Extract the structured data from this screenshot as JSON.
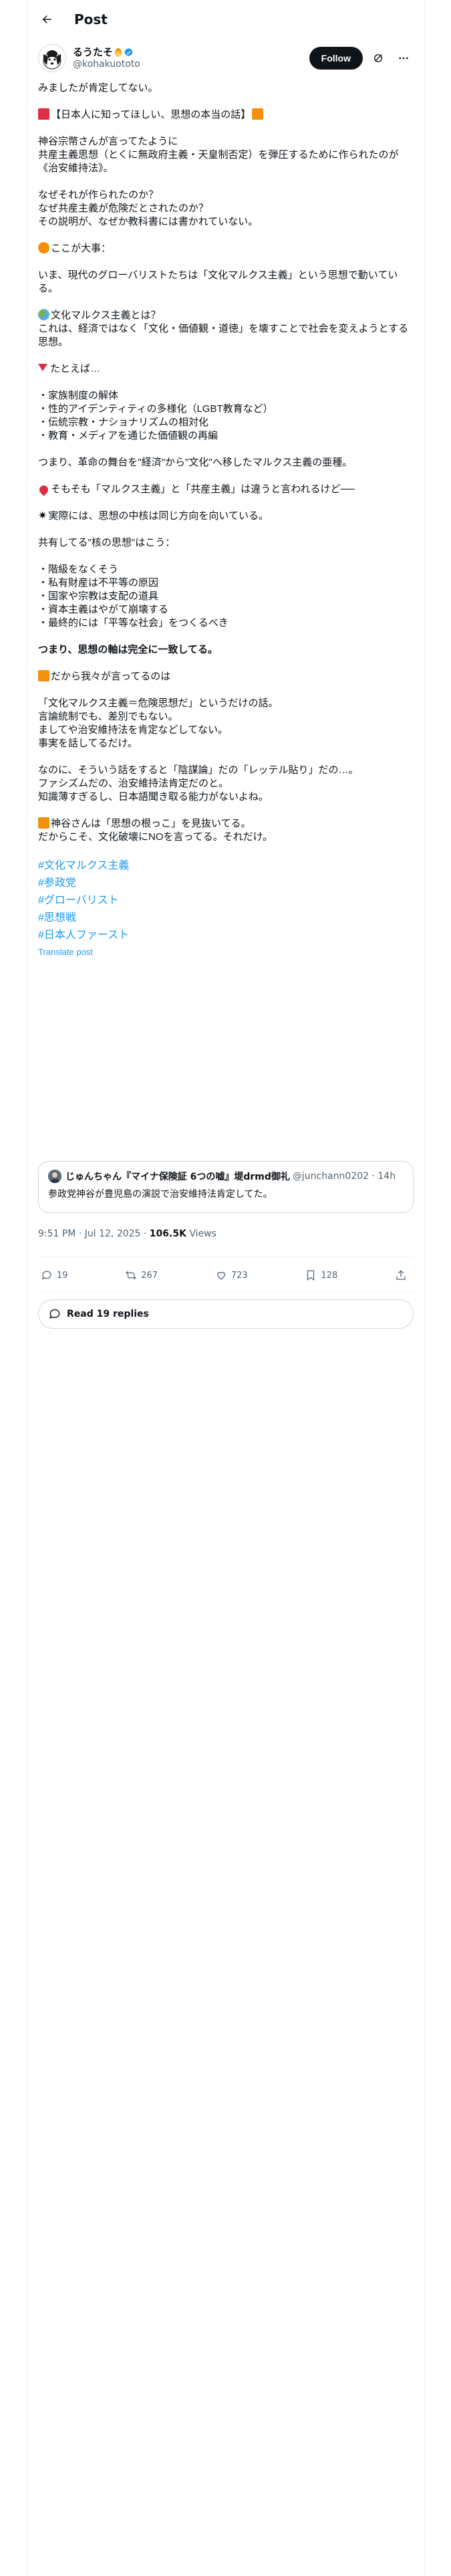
{
  "header": {
    "title": "Post"
  },
  "author": {
    "display_name": "るうたそ",
    "handle": "@kohakuototo",
    "follow_label": "Follow"
  },
  "post": {
    "lines": {
      "p1": "みましたが肯定してない。",
      "p2": "【日本人に知ってほしい、思想の本当の話】",
      "p3": "神谷宗幣さんが言ってたように\n共産主義思想（とくに無政府主義・天皇制否定）を弾圧するために作られたのが《治安維持法》。",
      "p4": "なぜそれが作られたのか？\nなぜ共産主義が危険だとされたのか？\nその説明が、なぜか教科書には書かれていない。",
      "p5": "ここが大事：",
      "p6": "いま、現代のグローバリストたちは「文化マルクス主義」という思想で動いている。",
      "p7a": "文化マルクス主義とは？",
      "p7b": "これは、経済ではなく「文化・価値観・道徳」を壊すことで社会を変えようとする思想。",
      "p8": "たとえば…",
      "p9": "・家族制度の解体\n・性的アイデンティティの多様化（LGBT教育など）\n・伝統宗教・ナショナリズムの相対化\n・教育・メディアを通じた価値観の再編",
      "p10": "つまり、革命の舞台を\"経済\"から\"文化\"へ移したマルクス主義の亜種。",
      "p11": "そもそも「マルクス主義」と「共産主義」は違うと言われるけど──",
      "p12": "実際には、思想の中核は同じ方向を向いている。",
      "p13": "共有してる\"核の思想\"はこう：",
      "p14": "・階級をなくそう\n・私有財産は不平等の原因\n・国家や宗教は支配の道具\n・資本主義はやがて崩壊する\n・最終的には「平等な社会」をつくるべき",
      "p15": "つまり、思想の軸は完全に一致してる。",
      "p16": "だから我々が言ってるのは",
      "p17": "「文化マルクス主義＝危険思想だ」というだけの話。\n言論統制でも、差別でもない。\nましてや治安維持法を肯定などしてない。\n事実を話してるだけ。",
      "p18": "なのに、そういう話をすると「陰謀論」だの「レッテル貼り」だの…。\nファシズムだの、治安維持法肯定だのと。\n知識薄すぎるし、日本語聞き取る能力がないよね。",
      "p19": "神谷さんは「思想の根っこ」を見抜いてる。\nだからこそ、文化破壊にNOを言ってる。それだけ。"
    },
    "hashtags": [
      "#文化マルクス主義",
      "#参政党",
      "#グローバリスト",
      "#思想戦",
      "#日本人ファースト"
    ],
    "translate_label": "Translate post"
  },
  "quote": {
    "name": "じゅんちゃん『マイナ保険証 6つの嘘』堤drmd御礼",
    "handle": "@junchann0202 · 14h",
    "text": "参政党神谷が豊児島の演説で治安維持法肯定してた。"
  },
  "meta": {
    "time": "9:51 PM · Jul 12, 2025 · ",
    "views_count": "106.5K",
    "views_label": " Views"
  },
  "actions": {
    "replies": "19",
    "reposts": "267",
    "likes": "723",
    "bookmarks": "128"
  },
  "read_replies": "Read 19 replies"
}
